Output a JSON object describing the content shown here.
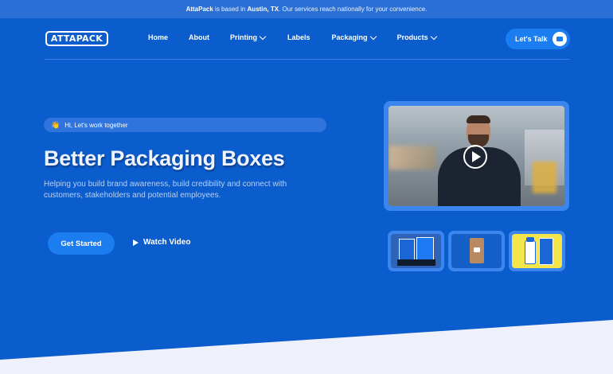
{
  "topbar": {
    "brand": "AttaPack",
    "text1": " is based in ",
    "location": "Austin, TX",
    "text2": ". Our services reach nationally for your convenience."
  },
  "nav": {
    "logo": "ATTAPACK",
    "items": [
      {
        "label": "Home",
        "dropdown": false
      },
      {
        "label": "About",
        "dropdown": false
      },
      {
        "label": "Printing",
        "dropdown": true
      },
      {
        "label": "Labels",
        "dropdown": false
      },
      {
        "label": "Packaging",
        "dropdown": true
      },
      {
        "label": "Products",
        "dropdown": true
      }
    ],
    "cta_label": "Let's Talk",
    "cta_icon": "mail-icon"
  },
  "hero": {
    "pill_icon": "waving-hand-icon",
    "pill_text": "Hi, Let's work together",
    "headline": "Better Packaging Boxes",
    "subtext": "Helping you build brand awareness, build credibility and connect with customers, stakeholders and potential employees.",
    "primary_button": "Get Started",
    "secondary_button": "Watch Video"
  },
  "colors": {
    "background": "#0b5ccc",
    "topbar": "#2a6fd6",
    "accent": "#1b7df0",
    "bottom_band": "#eef1fb"
  }
}
